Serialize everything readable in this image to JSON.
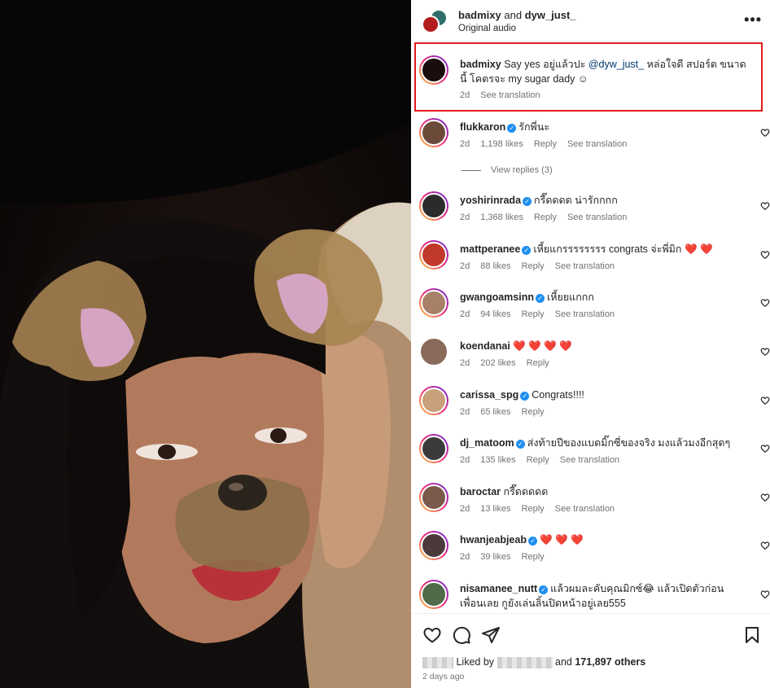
{
  "post": {
    "author_a": "badmixy",
    "and_text": " and ",
    "author_b": "dyw_just_",
    "audio": "Original audio"
  },
  "caption": {
    "username": "badmixy",
    "text_before": " Say yes อยู่แล้วปะ ",
    "mention": "@dyw_just_",
    "text_after": " หล่อใจดี สปอร์ต ขนาดนี้ โคตรจะ my sugar dady ☺",
    "time": "2d",
    "translate": "See translation"
  },
  "comments": [
    {
      "username": "flukkaron",
      "verified": true,
      "text": "รักพี่นะ",
      "time": "2d",
      "likes": "1,198 likes",
      "reply": "Reply",
      "translate": "See translation",
      "avatar_color": "#6b4a3a"
    },
    {
      "username": "yoshirinrada",
      "verified": true,
      "text": "กรี๊ดดดด น่ารักกกก",
      "time": "2d",
      "likes": "1,368 likes",
      "reply": "Reply",
      "translate": "See translation",
      "avatar_color": "#2b2b2b"
    },
    {
      "username": "mattperanee",
      "verified": true,
      "text": "เหี้ยแกรรรรรรรร congrats จ่ะพี่มิก ❤️ ❤️",
      "time": "2d",
      "likes": "88 likes",
      "reply": "Reply",
      "translate": "See translation",
      "avatar_color": "#c0392b"
    },
    {
      "username": "gwangoamsinn",
      "verified": true,
      "text": "เหี้ยยแกกก",
      "time": "2d",
      "likes": "94 likes",
      "reply": "Reply",
      "translate": "See translation",
      "avatar_color": "#a88068"
    },
    {
      "username": "koendanai",
      "verified": false,
      "text": "❤️ ❤️ ❤️ ❤️",
      "time": "2d",
      "likes": "202 likes",
      "reply": "Reply",
      "translate": "",
      "avatar_color": "#8a6a5a"
    },
    {
      "username": "carissa_spg",
      "verified": true,
      "text": "Congrats!!!!",
      "time": "2d",
      "likes": "65 likes",
      "reply": "Reply",
      "translate": "",
      "avatar_color": "#c8a07a"
    },
    {
      "username": "dj_matoom",
      "verified": true,
      "text": "ส่งท้ายปีของแบดมิ๊กซี่ของจริง มงแล้วมงอีกสุดๆ",
      "time": "2d",
      "likes": "135 likes",
      "reply": "Reply",
      "translate": "See translation",
      "avatar_color": "#3a3a3a"
    },
    {
      "username": "baroctar",
      "verified": false,
      "text": "กรี๊ดดดดด",
      "time": "2d",
      "likes": "13 likes",
      "reply": "Reply",
      "translate": "See translation",
      "avatar_color": "#7a5a4a"
    },
    {
      "username": "hwanjeabjeab",
      "verified": true,
      "text": "❤️ ❤️ ❤️",
      "time": "2d",
      "likes": "39 likes",
      "reply": "Reply",
      "translate": "",
      "avatar_color": "#4a3a3a"
    },
    {
      "username": "nisamanee_nutt",
      "verified": true,
      "text": "แล้วผมละคับคุณมิกซ์😂 แล้วเปิดตัวก่อนเพื่อนเลย กูยังเล่นลิ้นปิดหน้าอยู่เลย555",
      "time": "",
      "likes": "",
      "reply": "",
      "translate": "",
      "avatar_color": "#4f6b4a"
    }
  ],
  "view_replies": "View replies (3)",
  "footer": {
    "liked_prefix": "Liked by",
    "liked_suffix_and": "and",
    "liked_count": "171,897 others",
    "time_ago": "2 days ago"
  },
  "icons": {
    "more": "more-horizontal-icon",
    "like": "heart-icon",
    "comment": "comment-icon",
    "share": "share-icon",
    "save": "bookmark-icon"
  },
  "colors": {
    "highlight_box": "#e21b1b",
    "verified": "#1f8ff0",
    "mention": "#00376b"
  }
}
